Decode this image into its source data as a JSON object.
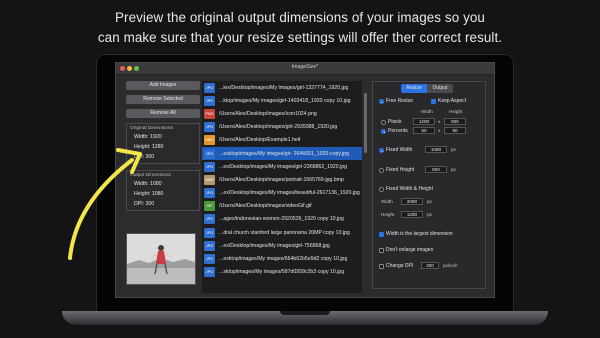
{
  "headline": {
    "line1": "Preview the original output dimensions of your images so you",
    "line2": "can make sure that your resize settings will offer ther correct result."
  },
  "window": {
    "title": "ImageSize*"
  },
  "left_panel": {
    "add_images": "Add Images",
    "remove_selected": "Remove Selected",
    "remove_all": "Remove All",
    "original_caption": "Original Dimensions",
    "original": {
      "width": "Width: 1920",
      "height": "Height: 1280",
      "dpi": "DPI: 300"
    },
    "output_caption": "Output Dimensions",
    "output": {
      "width": "Width: 1080",
      "height": "Height: 1080",
      "dpi": "DPI: 300"
    }
  },
  "files": [
    {
      "type": "JPG",
      "color": "#2e6fcf",
      "name": "...lex/Desktop/images/My Images/girl-1327774_1920.jpg",
      "selected": false
    },
    {
      "type": "JPG",
      "color": "#2e6fcf",
      "name": "...ktop/images/My images/girl-1403418_1920 copy 10.jpg",
      "selected": false
    },
    {
      "type": "PNG",
      "color": "#c9463d",
      "name": "/Users/Alex/Desktop/images/icon1024.png",
      "selected": false
    },
    {
      "type": "JPG",
      "color": "#2e6fcf",
      "name": "/Users/Alex/Desktop/images/girl-2939388_1920.jpg",
      "selected": false
    },
    {
      "type": "HEIC",
      "color": "#e0962a",
      "name": "/Users/Alex/Desktop/Example1.heif",
      "selected": false
    },
    {
      "type": "JPG",
      "color": "#2e6fcf",
      "name": "...esktop/images/My images/gir- 2646651_1920-copy.jpg",
      "selected": true
    },
    {
      "type": "JPG",
      "color": "#2e6fcf",
      "name": "...ex/Desktop/images/My images/girl-2368862_1920.jpg",
      "selected": false
    },
    {
      "type": "BMP",
      "color": "#b39a6a",
      "name": "/Users/Alex/Desktop/images/portrait-1565769-jpg.bmp",
      "selected": false
    },
    {
      "type": "JPG",
      "color": "#2e6fcf",
      "name": "...ex/Desktop/images/My images/beautiful-2617136_1920.jpg",
      "selected": false
    },
    {
      "type": "GIF",
      "color": "#4a9a3c",
      "name": "/Users/Alex/Desktop/images/videoGif.gif",
      "selected": false
    },
    {
      "type": "JPG",
      "color": "#2e6fcf",
      "name": "...ages/indonesian-women-2920535_1920 copy 10.jpg",
      "selected": false
    },
    {
      "type": "JPG",
      "color": "#2e6fcf",
      "name": "...dral church stanford large panorama 20MP copy 10.jpg",
      "selected": false
    },
    {
      "type": "JPG",
      "color": "#2e6fcf",
      "name": "...ex/Desktop/images/My images/girl-756868.jpg",
      "selected": false
    },
    {
      "type": "JPG",
      "color": "#2e6fcf",
      "name": "...esktop/images/My images/664b62b5e9d2 copy 10.jpg",
      "selected": false
    },
    {
      "type": "JPG",
      "color": "#2e6fcf",
      "name": "...sktop/images/My images/587d0959c2b3 copy 10.jpg",
      "selected": false
    }
  ],
  "right_panel": {
    "tab_resize": "Resize",
    "tab_output": "Output",
    "free_resize": "Free Resize",
    "keep_aspect": "Keep Aspect",
    "col_width": "Width",
    "col_height": "Height",
    "pixels_label": "Pixels",
    "pixels_w": "1200",
    "pixels_x": "x",
    "pixels_h": "800",
    "percents_label": "Percents",
    "percents_w": "50",
    "percents_x": "x",
    "percents_h": "50",
    "fixed_width_label": "Fixed Width",
    "fixed_width_val": "1080",
    "fixed_width_unit": "px",
    "fixed_height_label": "Fixed Height",
    "fixed_height_val": "800",
    "fixed_height_unit": "px",
    "fixed_wh_label": "Fixed Width & Height",
    "wh_width_label": "Width",
    "wh_width_val": "2080",
    "wh_width_unit": "px",
    "wh_height_label": "Height",
    "wh_height_val": "1280",
    "wh_height_unit": "px",
    "largest_dim": "Width is the largest dimension",
    "dont_enlarge": "Don't enlarge images",
    "change_dpi": "Change DPI",
    "dpi_val": "300",
    "dpi_unit": "px/inch"
  },
  "colors": {
    "accent": "#2a74e6",
    "arrow": "#f2e64a"
  }
}
